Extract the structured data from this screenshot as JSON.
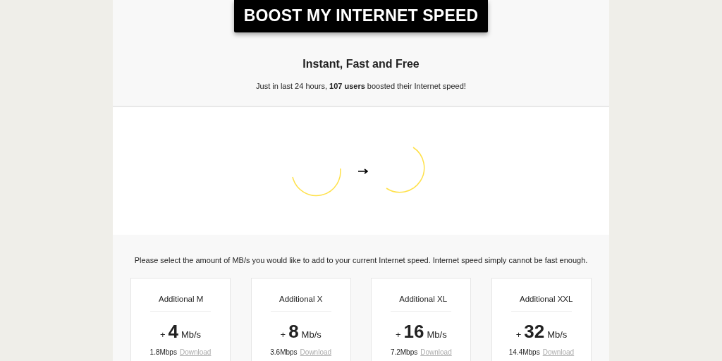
{
  "banner": {
    "title": "BOOST MY INTERNET SPEED"
  },
  "hero": {
    "heading": "Instant, Fast and Free",
    "subtext": "Just in last 24 hours, **107 users** boosted their Internet speed!"
  },
  "instructions": "Please select the amount of MB/s you would like to add to your current Internet speed. Internet speed simply cannot be fast enough.",
  "plans": [
    {
      "name": "Additional M",
      "plus": "+",
      "amount": "4",
      "unit": "Mb/s",
      "rate": "1.8Mbps",
      "action": "Download"
    },
    {
      "name": "Additional X",
      "plus": "+",
      "amount": "8",
      "unit": "Mb/s",
      "rate": "3.6Mbps",
      "action": "Download"
    },
    {
      "name": "Additional XL",
      "plus": "+",
      "amount": "16",
      "unit": "Mb/s",
      "rate": "7.2Mbps",
      "action": "Download"
    },
    {
      "name": "Additional XXL",
      "plus": "+",
      "amount": "32",
      "unit": "Mb/s",
      "rate": "14.4Mbps",
      "action": "Download"
    }
  ]
}
